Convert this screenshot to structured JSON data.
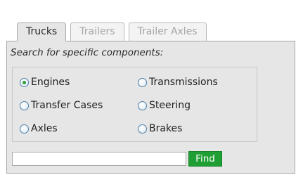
{
  "tabs": [
    {
      "label": "Trucks",
      "active": true
    },
    {
      "label": "Trailers",
      "active": false
    },
    {
      "label": "Trailer Axles",
      "active": false
    }
  ],
  "search": {
    "label": "Search for specific components:",
    "input_value": "",
    "input_placeholder": "",
    "button_label": "Find"
  },
  "options": [
    {
      "label": "Engines",
      "selected": true
    },
    {
      "label": "Transmissions",
      "selected": false
    },
    {
      "label": "Transfer Cases",
      "selected": false
    },
    {
      "label": "Steering",
      "selected": false
    },
    {
      "label": "Axles",
      "selected": false
    },
    {
      "label": "Brakes",
      "selected": false
    }
  ],
  "colors": {
    "accent_green": "#1f9e34",
    "panel_bg": "#e6e6e6",
    "radio_border": "#4d7fa8"
  }
}
